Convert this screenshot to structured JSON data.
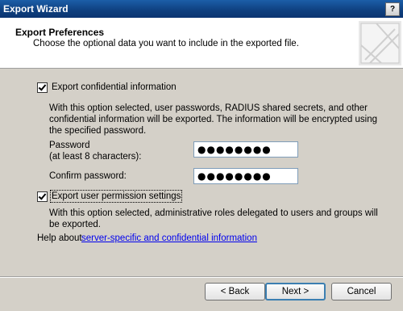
{
  "window": {
    "title": "Export Wizard",
    "help_glyph": "?"
  },
  "header": {
    "title": "Export Preferences",
    "subtitle": "Choose the optional data you want to include in the exported file."
  },
  "confidential": {
    "checkbox_label": "Export confidential information",
    "checked": true,
    "description": "With this option selected, user passwords, RADIUS shared secrets, and other confidential information will be exported. The information will be encrypted using the specified password.",
    "password_label_1": "Password",
    "password_label_2": "(at least 8 characters):",
    "password_value": "●●●●●●●●",
    "confirm_label": "Confirm password:",
    "confirm_value": "●●●●●●●●"
  },
  "permissions": {
    "checkbox_label": "Export user permission settings",
    "checked": true,
    "description": "With this option selected, administrative roles delegated to users and groups will be exported."
  },
  "help": {
    "prefix": "Help about ",
    "link_text": "server-specific and confidential information"
  },
  "buttons": {
    "back": "< Back",
    "next": "Next >",
    "cancel": "Cancel"
  }
}
